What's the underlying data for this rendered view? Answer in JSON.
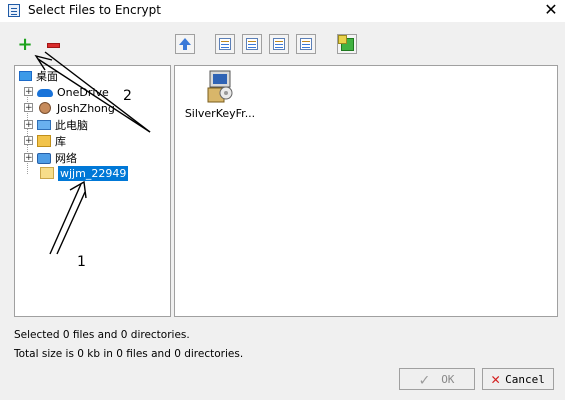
{
  "window": {
    "title": "Select Files to Encrypt",
    "close_glyph": "✕"
  },
  "toolbar": {
    "left": [
      {
        "name": "add-button",
        "icon": "plus-icon",
        "color": "#1da21d"
      },
      {
        "name": "remove-button",
        "icon": "minus-icon",
        "color": "#d92b2b"
      }
    ],
    "right": [
      {
        "name": "up-folder-button",
        "icon": "up-arrow-icon"
      },
      {
        "name": "view-large-icons-button",
        "icon": "large-icons-view-icon"
      },
      {
        "name": "view-small-icons-button",
        "icon": "small-icons-view-icon"
      },
      {
        "name": "view-list-button",
        "icon": "list-view-icon"
      },
      {
        "name": "view-details-button",
        "icon": "details-view-icon"
      },
      {
        "name": "copy-button",
        "icon": "copy-icon"
      }
    ]
  },
  "tree": {
    "items": [
      {
        "label": "桌面",
        "icon": "desktop-icon"
      },
      {
        "label": "OneDrive",
        "icon": "cloud-icon"
      },
      {
        "label": "JoshZhong",
        "icon": "user-icon"
      },
      {
        "label": "此电脑",
        "icon": "computer-icon"
      },
      {
        "label": "库",
        "icon": "library-icon"
      },
      {
        "label": "网络",
        "icon": "network-icon"
      },
      {
        "label": "wjjm_22949",
        "icon": "folder-icon",
        "selected": true
      }
    ]
  },
  "files": [
    {
      "label": "SilverKeyFr...",
      "icon": "installer-icon"
    }
  ],
  "status": {
    "selected": "Selected 0 files and 0 directories.",
    "total": "Total size is 0 kb in 0 files and 0 directories."
  },
  "buttons": {
    "ok": "OK",
    "cancel": "Cancel"
  },
  "annotations": {
    "one": "1",
    "two": "2"
  },
  "colors": {
    "selection": "#0078d7",
    "background": "#f0f0f0"
  }
}
